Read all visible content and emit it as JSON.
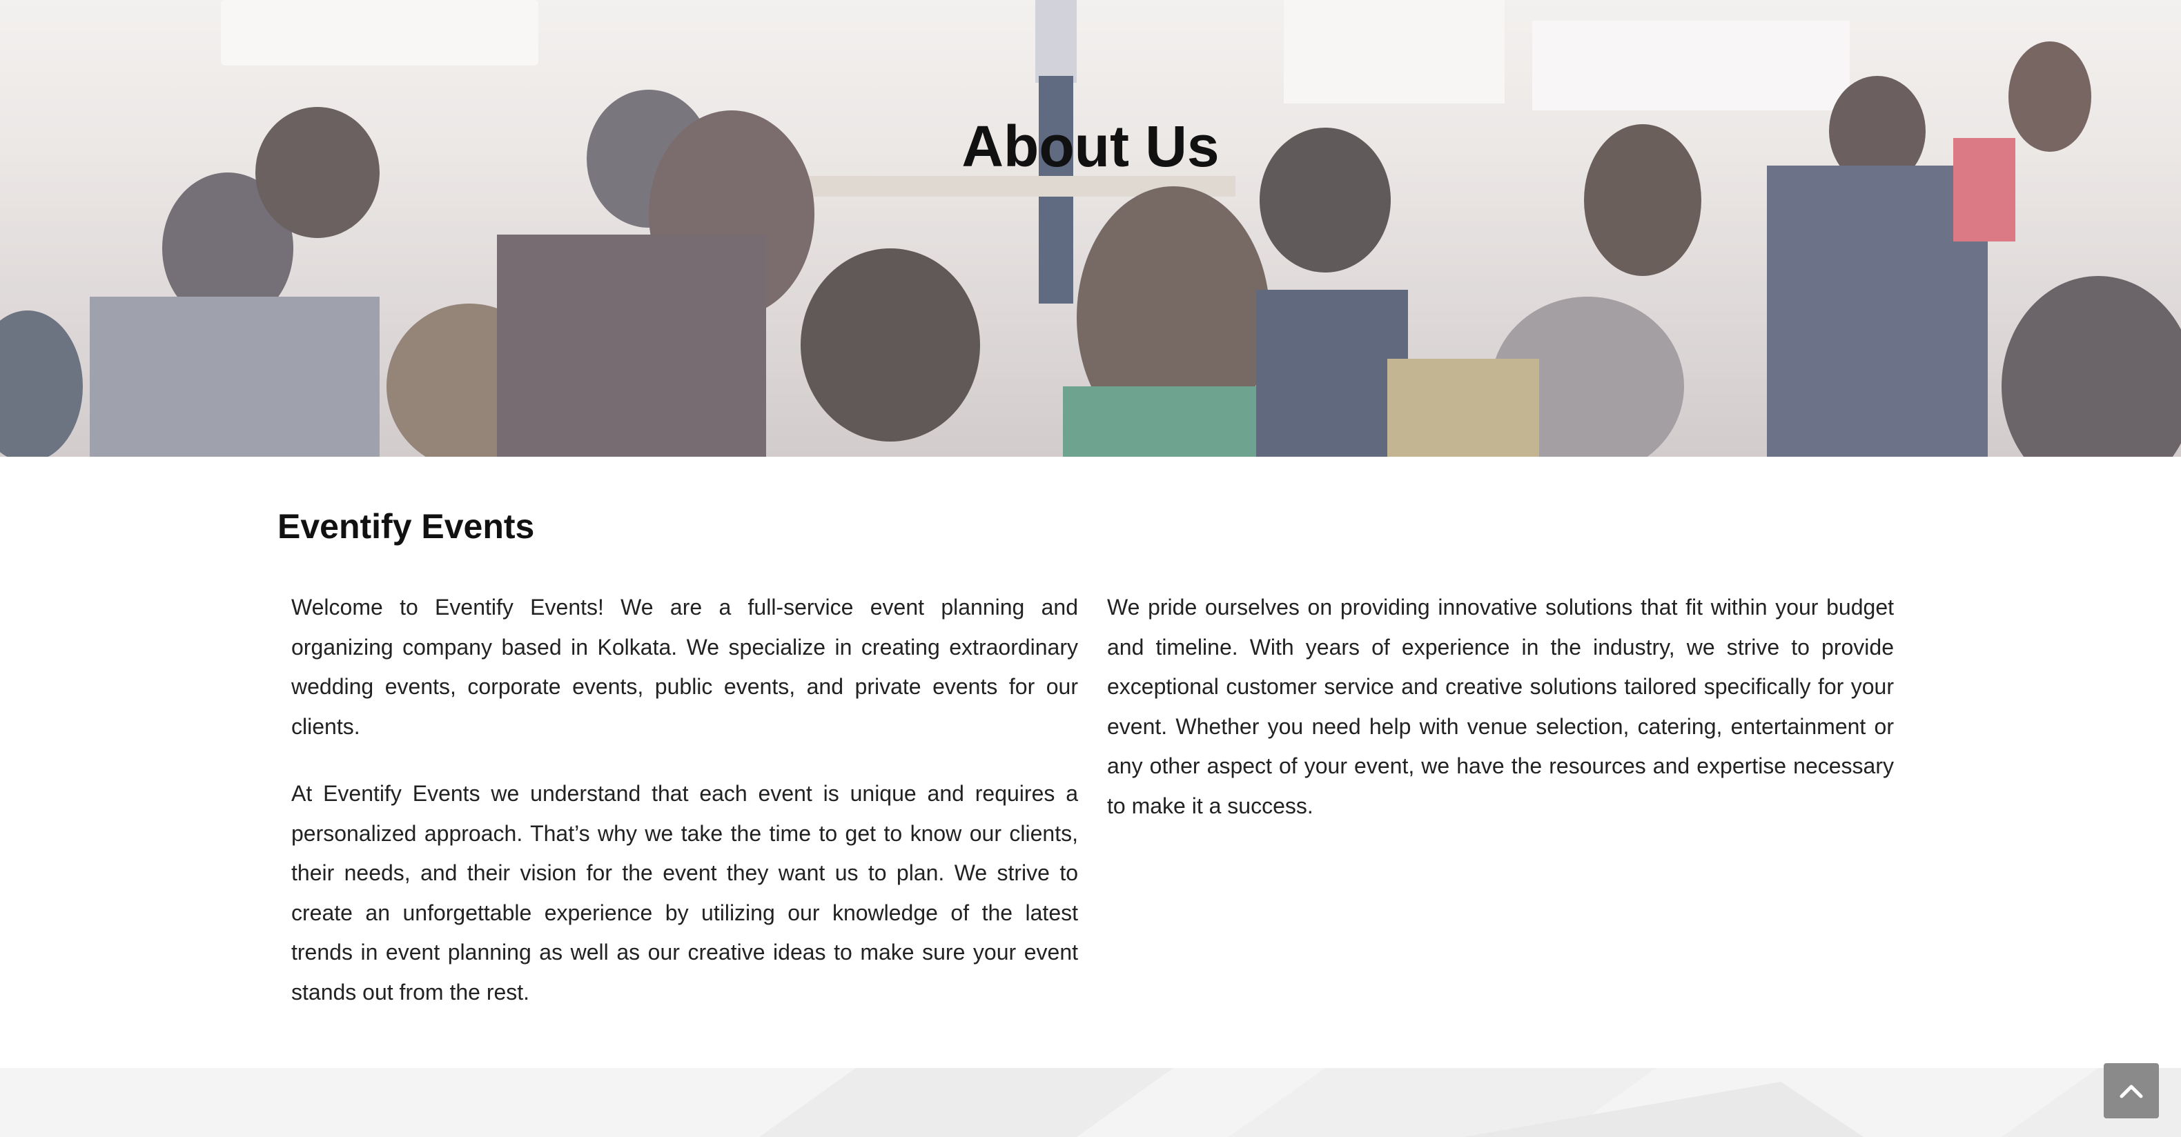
{
  "hero": {
    "title": "About Us",
    "image_alt": "audience-at-seminar-photo"
  },
  "about": {
    "heading": "Eventify Events",
    "left_paragraphs": [
      "Welcome to Eventify Events! We are a full-service event planning and organizing company based in Kolkata. We specialize in creating extraordinary wedding events, corporate events, public events, and private events for our clients.",
      "At Eventify Events we understand that each event is unique and requires a personalized approach. That’s why we take the time to get to know our clients, their needs, and their vision for the event they want us to plan. We strive to create an unforgettable experience by utilizing our knowledge of the latest trends in event planning as well as our creative ideas to make sure your event stands out from the rest."
    ],
    "right_paragraphs": [
      "We pride ourselves on providing innovative solutions that fit within your budget and timeline. With years of experience in the industry, we strive to provide exceptional customer service and creative solutions tailored specifically for your event. Whether you need help with venue selection, catering, entertainment or any other aspect of your event, we have the resources and expertise necessary to make it a success."
    ]
  },
  "scroll_top": {
    "icon": "chevron-up-icon"
  },
  "colors": {
    "heading": "#111111",
    "body_text": "#222222",
    "scroll_button": "#8a8a8a",
    "footer_strip": "#f4f4f4"
  }
}
